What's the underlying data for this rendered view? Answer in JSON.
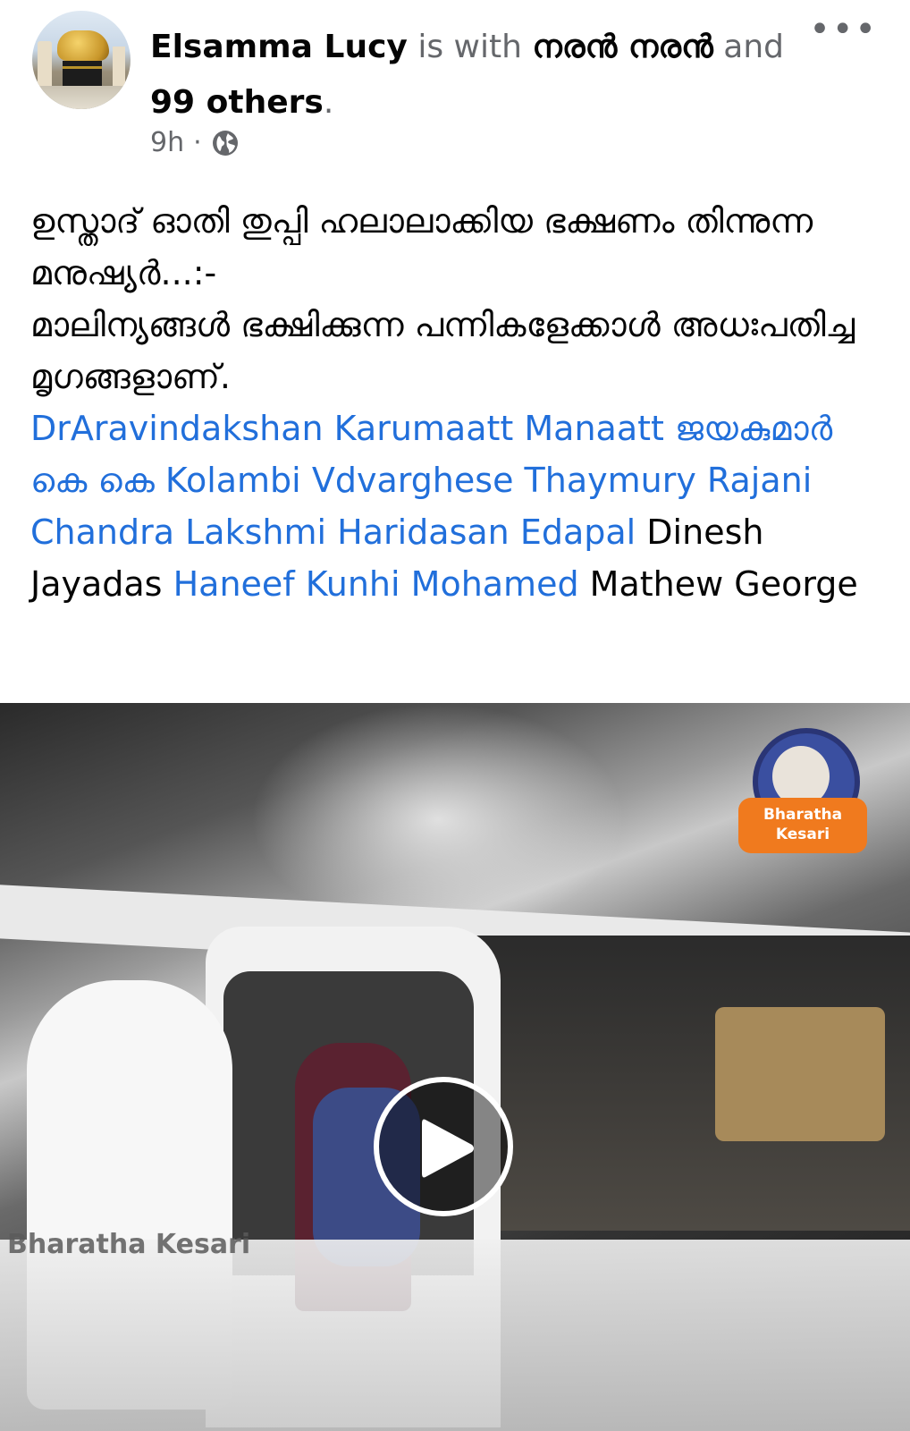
{
  "post": {
    "author": "Elsamma Lucy",
    "with_text": " is with ",
    "tagged_primary": "നരൻ നരൻ",
    "and_text": " and ",
    "others": "99 others",
    "period": ".",
    "time": "9h",
    "separator": "·",
    "privacy_icon": "globe-icon",
    "more_icon": "more-horizontal-icon",
    "more_label": "•••"
  },
  "body": {
    "malayalam_line1": "ഉസ്താദ് ഓതി തുപ്പി ഹലാലാക്കിയ ഭക്ഷണം തിന്നുന്ന മനുഷ്യർ...:-",
    "malayalam_line2": "മാലിന്യങ്ങൾ ഭക്ഷിക്കുന്ന പന്നികളേക്കാൾ അധഃപതിച്ച മൃഗങ്ങളാണ്.",
    "tag1": "DrAravindakshan Karumaatt Manaatt",
    "tag2": "ജയകുമാർ കെ കെ Kolambi",
    "tag3": "Vdvarghese Thaymury",
    "tag4": "Rajani Chandra",
    "tag5": "Lakshmi Haridasan Edapal",
    "plain1": "Dinesh Jayadas",
    "tag6": "Haneef Kunhi Mohamed",
    "plain2": "Mathew George"
  },
  "video": {
    "logo_text_line1": "Bharatha",
    "logo_text_line2": "Kesari",
    "watermark": "Bharatha Kesari",
    "play_icon": "play-icon"
  },
  "colors": {
    "link": "#216fdb",
    "text": "#050505",
    "muted": "#65676b",
    "logo_orange": "#f07a1e"
  }
}
